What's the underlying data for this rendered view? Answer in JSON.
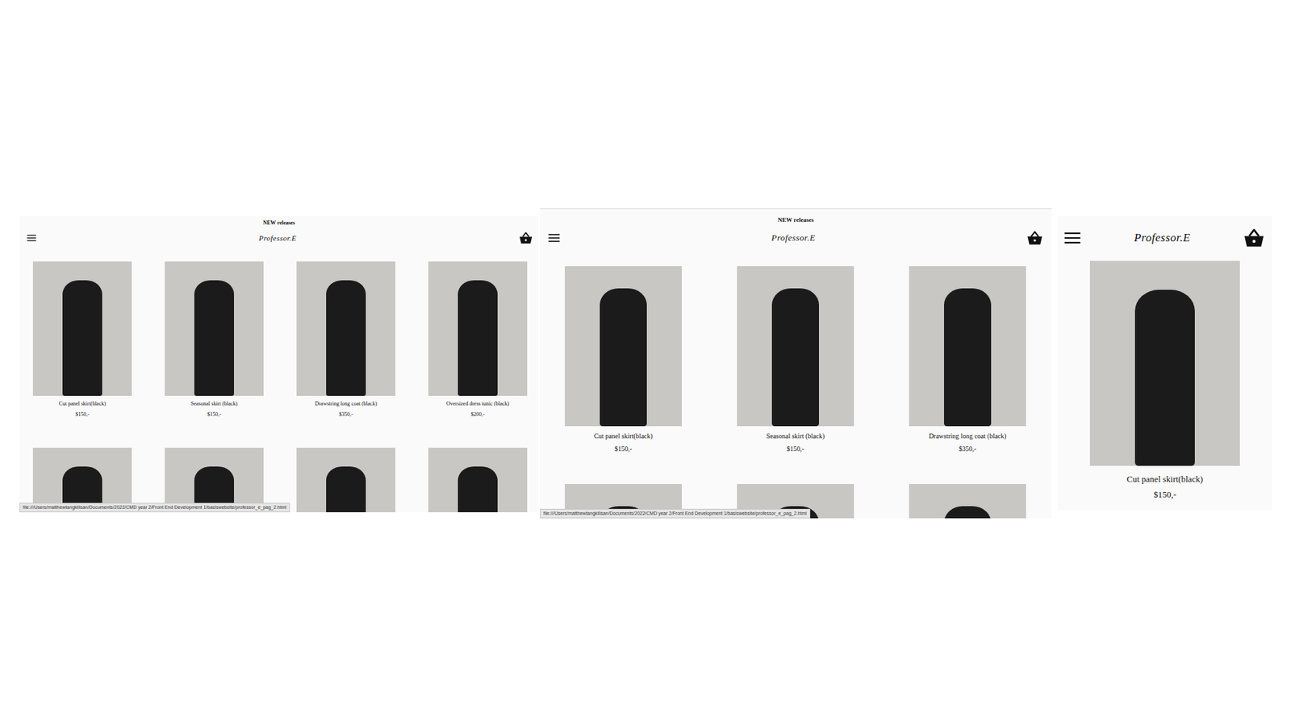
{
  "views": [
    {
      "kind": "desktop",
      "banner": "NEW releases",
      "logo": "Professor.E",
      "products": [
        {
          "name": "Cut panel skirt(black)",
          "price": "$150,-"
        },
        {
          "name": "Seasonal skirt (black)",
          "price": "$150,-"
        },
        {
          "name": "Drawstring long coat (black)",
          "price": "$350,-"
        },
        {
          "name": "Oversized dress tunic (black)",
          "price": "$200,-"
        }
      ],
      "cut_off_cards": 4,
      "status_url": "file:///Users/matthewtangkilisan/Documents/2022/CMD year 2/Front End Development 1/basiswebsite/professor_e_pag_2.html"
    },
    {
      "kind": "tablet",
      "banner": "NEW releases",
      "logo": "Professor.E",
      "products": [
        {
          "name": "Cut panel skirt(black)",
          "price": "$150,-"
        },
        {
          "name": "Seasonal skirt (black)",
          "price": "$150,-"
        },
        {
          "name": "Drawstring long coat (black)",
          "price": "$350,-"
        }
      ],
      "cut_off_cards": 3,
      "status_url": "file:///Users/matthewtangkilisan/Documents/2022/CMD year 2/Front End Development 1/basiswebsite/professor_e_pag_2.html"
    },
    {
      "kind": "mobile",
      "banner": "",
      "logo": "Professor.E",
      "products": [
        {
          "name": "Cut panel skirt(black)",
          "price": "$150,-"
        }
      ],
      "cut_off_cards": 0,
      "status_url": ""
    }
  ]
}
